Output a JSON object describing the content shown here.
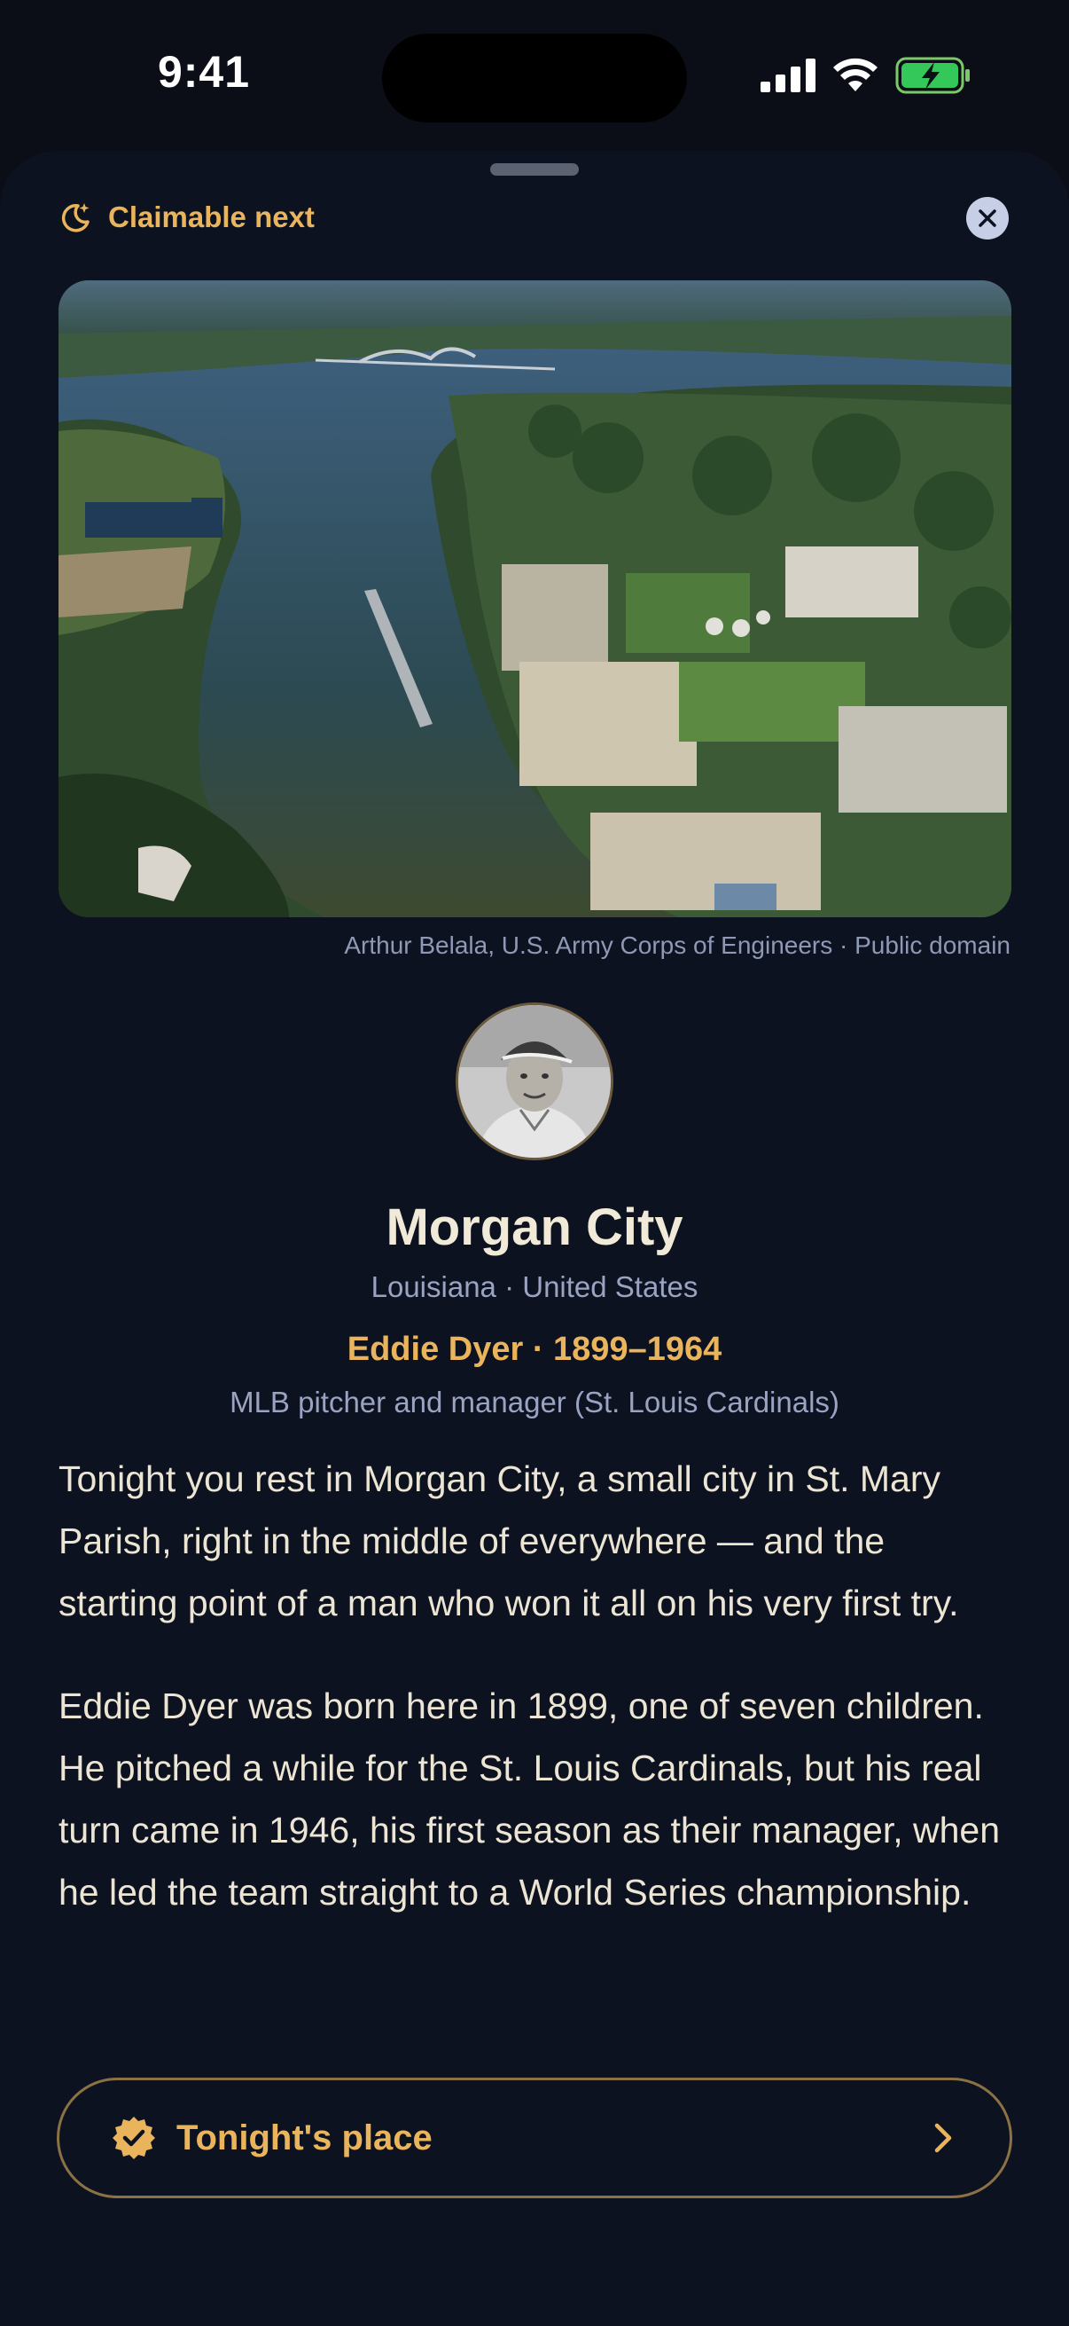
{
  "status_bar": {
    "time": "9:41"
  },
  "sheet": {
    "badge": {
      "icon": "moon-sparkle-icon",
      "label": "Claimable next"
    },
    "close": {
      "icon": "close-icon"
    }
  },
  "photo": {
    "credit": "Arthur Belala, U.S. Army Corps of Engineers · Public domain"
  },
  "place": {
    "title": "Morgan City",
    "region": "Louisiana · United States"
  },
  "person": {
    "line": "Eddie Dyer · 1899–1964",
    "role": "MLB pitcher and manager (St. Louis Cardinals)"
  },
  "story": {
    "paragraphs": [
      "Tonight you rest in Morgan City, a small city in St. Mary Parish, right in the middle of everywhere — and the starting point of a man who won it all on his very first try.",
      "Eddie Dyer was born here in 1899, one of seven children. He pitched a while for the St. Louis Cardinals, but his real turn came in 1946, his first season as their manager, when he led the team straight to a World Series championship."
    ]
  },
  "cta": {
    "icon": "verified-badge-icon",
    "label": "Tonight's place",
    "chevron": "chevron-right-icon"
  },
  "colors": {
    "accent": "#e9b45c",
    "background": "#0b0e16",
    "sheet": "#0d1220",
    "muted": "#9aa3c2"
  }
}
